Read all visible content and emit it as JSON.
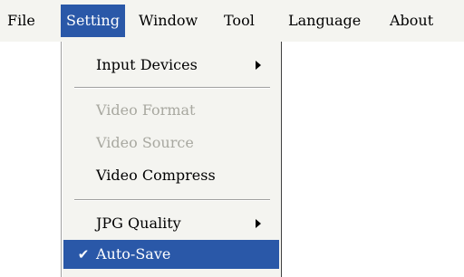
{
  "menubar": {
    "items": [
      {
        "label": "File"
      },
      {
        "label": "Setting"
      },
      {
        "label": "Window"
      },
      {
        "label": "Tool"
      },
      {
        "label": "Language"
      },
      {
        "label": "About"
      }
    ]
  },
  "setting_menu": {
    "items": [
      {
        "label": "Input Devices",
        "enabled": true,
        "has_submenu": true
      },
      {
        "label": "Video Format",
        "enabled": false
      },
      {
        "label": "Video Source",
        "enabled": false
      },
      {
        "label": "Video Compress",
        "enabled": true
      },
      {
        "label": "JPG Quality",
        "enabled": true,
        "has_submenu": true
      },
      {
        "label": "Auto-Save",
        "enabled": true,
        "checked": true,
        "highlighted": true
      }
    ],
    "check_glyph": "✔"
  },
  "colors": {
    "highlight": "#2a58a8",
    "menu_background": "#f4f4f0",
    "disabled_text": "#a8a8a0"
  }
}
